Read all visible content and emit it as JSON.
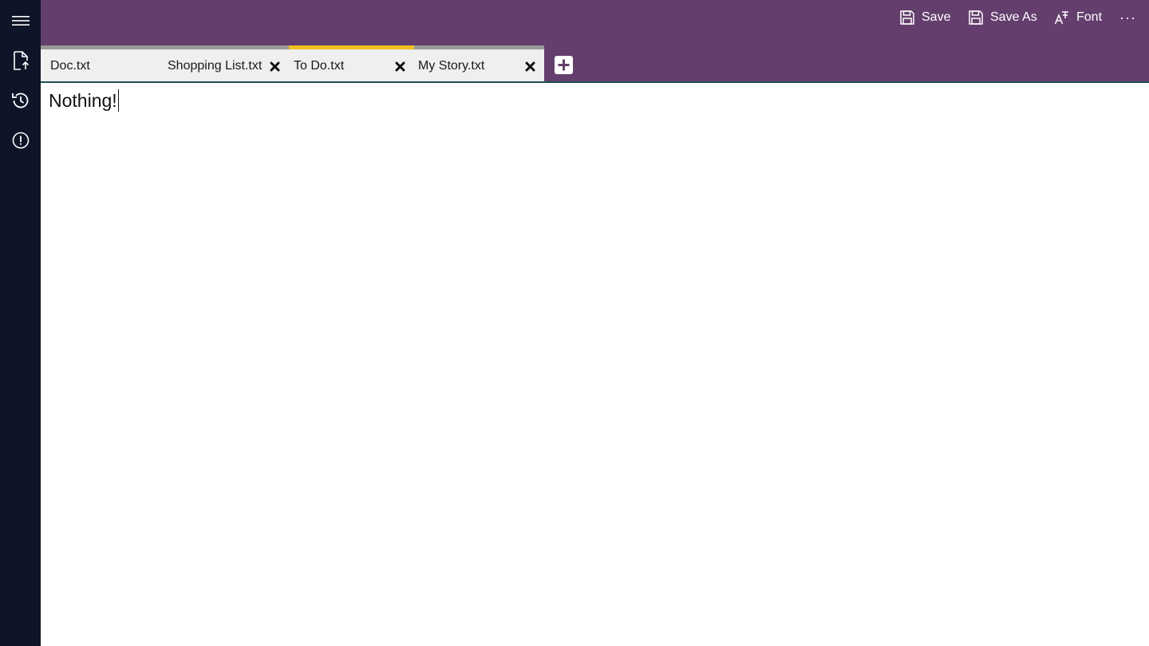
{
  "toolbar": {
    "save_label": "Save",
    "save_as_label": "Save As",
    "font_label": "Font",
    "more_label": "···"
  },
  "rail": {
    "items": [
      {
        "icon": "hamburger-menu-icon"
      },
      {
        "icon": "open-file-icon"
      },
      {
        "icon": "history-icon"
      },
      {
        "icon": "info-icon"
      }
    ]
  },
  "tabs": [
    {
      "label": "Doc.txt",
      "active": false,
      "closable": false
    },
    {
      "label": "Shopping List.txt",
      "active": false,
      "closable": true
    },
    {
      "label": "To Do.txt",
      "active": true,
      "closable": true
    },
    {
      "label": "My Story.txt",
      "active": false,
      "closable": true
    }
  ],
  "editor": {
    "content": "Nothing!"
  },
  "colors": {
    "titlebar": "#643f6e",
    "rail": "#0f1528",
    "active_tab_accent": "#f0c020",
    "inactive_tab_accent": "#9a9a9a"
  }
}
